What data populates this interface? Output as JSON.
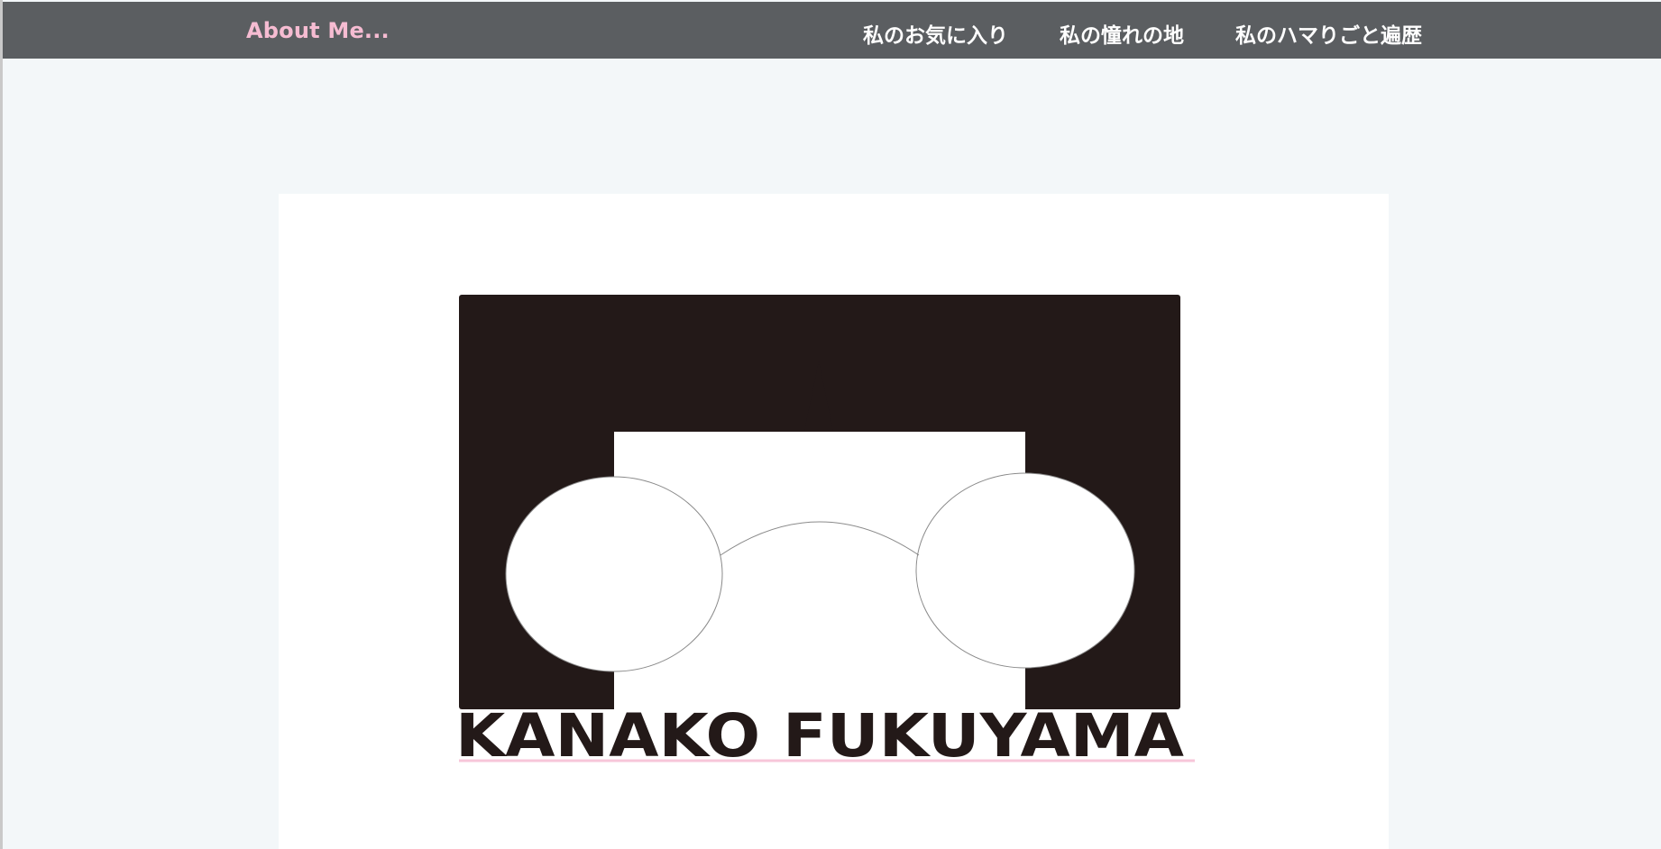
{
  "nav": {
    "brand": "About Me...",
    "links": [
      {
        "label": "私のお気に入り"
      },
      {
        "label": "私の憧れの地"
      },
      {
        "label": "私のハマりごと遍歴"
      }
    ]
  },
  "hero": {
    "logo_text": "KANAKO FUKUYAMA"
  },
  "colors": {
    "nav_bg": "#5b5e61",
    "brand": "#f6bcd2",
    "page_bg": "#f3f7f9",
    "logo_dark": "#231918",
    "underline": "#f7c6d9"
  }
}
